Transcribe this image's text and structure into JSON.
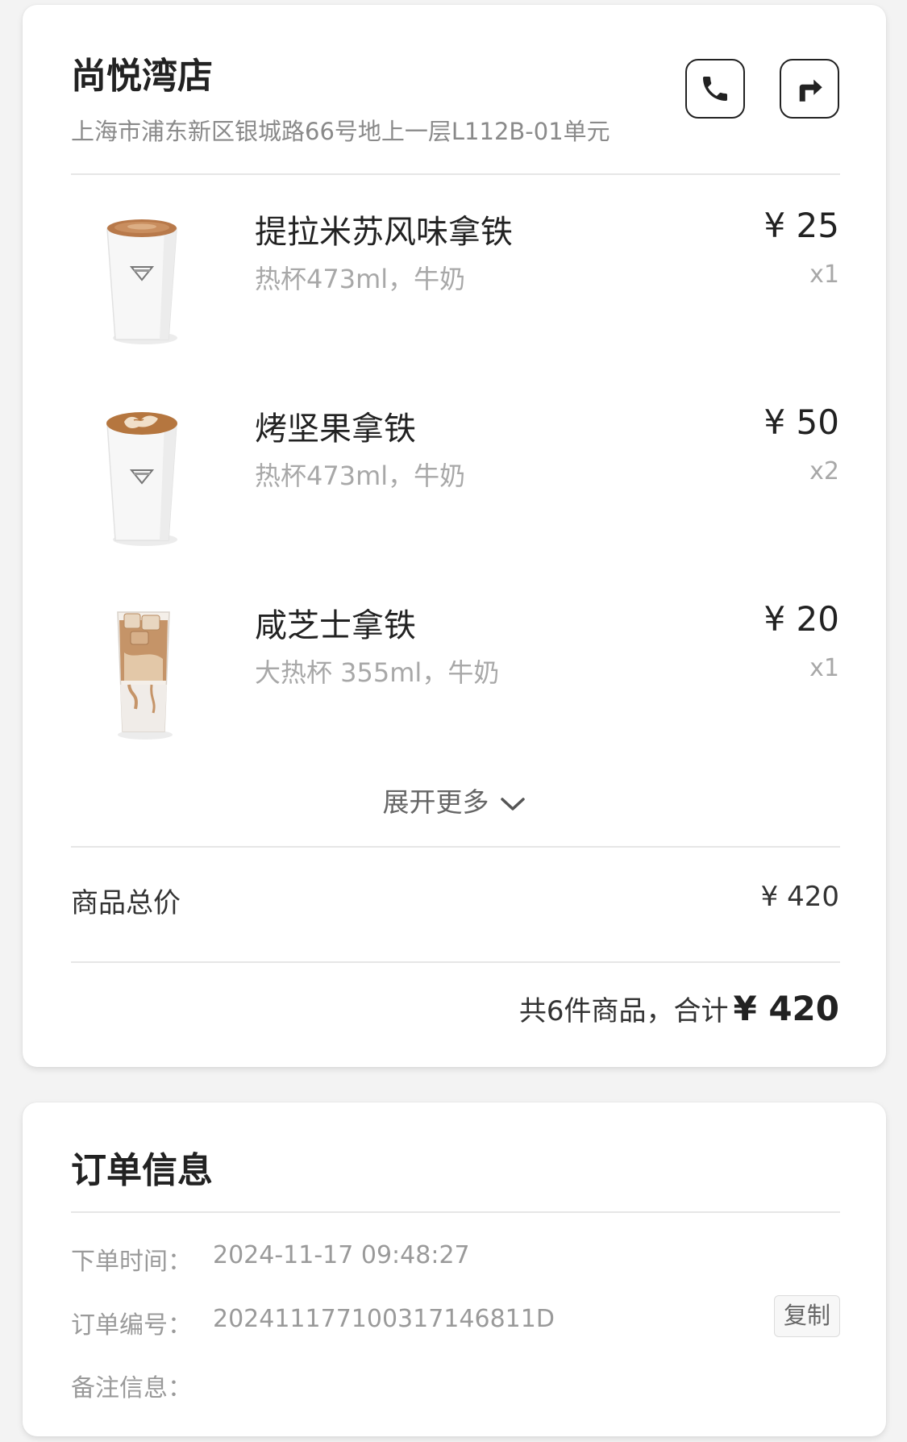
{
  "store": {
    "name": "尚悦湾店",
    "address": "上海市浦东新区银城路66号地上一层L112B-01单元"
  },
  "items": [
    {
      "name": "提拉米苏风味拿铁",
      "spec": "热杯473ml，牛奶",
      "price": "¥ 25",
      "qty": "x1",
      "drink": "hot-latte"
    },
    {
      "name": "烤坚果拿铁",
      "spec": "热杯473ml，牛奶",
      "price": "¥ 50",
      "qty": "x2",
      "drink": "hot-latte-art"
    },
    {
      "name": "咸芝士拿铁",
      "spec": "大热杯 355ml，牛奶",
      "price": "¥ 20",
      "qty": "x1",
      "drink": "iced-latte"
    }
  ],
  "expand_label": "展开更多",
  "summary": {
    "subtotal_label": "商品总价",
    "subtotal_value": "¥ 420",
    "total_prefix": "共6件商品，合计",
    "total_amount": "¥ 420"
  },
  "order": {
    "title": "订单信息",
    "time_label": "下单时间：",
    "time_value": "2024-11-17 09:48:27",
    "number_label": "订单编号：",
    "number_value": "202411177100317146811D",
    "copy_label": "复制",
    "note_label": "备注信息："
  },
  "icons": {
    "call": "phone-icon",
    "navigate": "directions-icon",
    "expand": "chevron-down-icon"
  }
}
